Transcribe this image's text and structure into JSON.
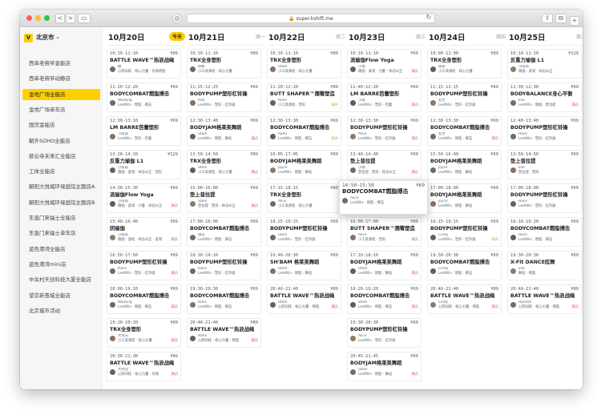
{
  "browser": {
    "url": "super.kshift.me",
    "back": "<",
    "forward": ">",
    "sidebar_toggle": "▭",
    "share": "⇧",
    "tabs": "⧉",
    "new_tab": "+",
    "colors": {
      "close": "#fd5f57",
      "min": "#febc2e",
      "max": "#28c840"
    }
  },
  "sidebar": {
    "logo": "V",
    "city": "北京市",
    "items": [
      {
        "label": "西单老佛爷金能店"
      },
      {
        "label": "西单老佛爷动静店"
      },
      {
        "label": "金地广场全能店",
        "active": true
      },
      {
        "label": "金地广场单车店"
      },
      {
        "label": "国贸金能店"
      },
      {
        "label": "朝外SOHO全能店"
      },
      {
        "label": "慈云寺未来汇全能店"
      },
      {
        "label": "工体全能店"
      },
      {
        "label": "朝阳大悦城环境庭院主题店A"
      },
      {
        "label": "朝阳大悦城环境庭院主题店B"
      },
      {
        "label": "东直门来福士全能店"
      },
      {
        "label": "东直门来福士单车店"
      },
      {
        "label": "蓝色港湾全能店"
      },
      {
        "label": "蓝色港湾mini店"
      },
      {
        "label": "中关村天创科技大厦全能店"
      },
      {
        "label": "望京新荟城全能店"
      },
      {
        "label": "北京城市活动"
      }
    ]
  },
  "days": [
    {
      "date": "10月20日",
      "weekday": "今天",
      "today": true,
      "classes": [
        {
          "time": "10:10-11:10",
          "price": "¥89",
          "name": "BATTLE WAVE™热浪战绳",
          "coach": "糖",
          "info": "心肺训练 · 核心力量 · 有氧燃脂"
        },
        {
          "time": "11:20-12:20",
          "price": "¥69",
          "name": "BODYCOMBAT燃脂搏击",
          "coach": "Wanting",
          "info": "LesMills · 燃脂 · 搏击"
        },
        {
          "time": "12:30-13:10",
          "price": "¥69",
          "name": "LM BARRE芭蕾塑形",
          "coach": "小南南",
          "info": "LesMills · 塑形 · 芭蕾"
        },
        {
          "time": "13:20-14:20",
          "price": "¥129",
          "name": "反重力瑜伽 L1",
          "coach": "小南南",
          "info": "瑜伽 · 柔韧 · 体态纠正 · 塑形"
        },
        {
          "time": "14:30-15:30",
          "price": "¥69",
          "name": "流瑜伽Flow Yoga",
          "coach": "小南南",
          "info": "瑜伽 · 柔韧 · 力量 · 体态纠正",
          "badge": "满员"
        },
        {
          "time": "15:40-16:40",
          "price": "¥69",
          "name": "阴瑜伽",
          "coach": "小南南",
          "info": "瑜伽 · 放松 · 体态纠正 · 柔韧",
          "badge": "满员"
        },
        {
          "time": "16:50-17:50",
          "price": "¥69",
          "name": "BODYPUMP塑形杠铃操",
          "coach": "Hans",
          "info": "LesMills · 塑形 · 杠铃操",
          "badge": "满员"
        },
        {
          "time": "18:00-19:10",
          "price": "¥69",
          "name": "BODYCOMBAT燃脂搏击",
          "coach": "Wanting",
          "info": "LesMills · 燃脂 · 搏击",
          "badge": "满员"
        },
        {
          "time": "19:20-20:20",
          "price": "¥89",
          "name": "TRX全身塑形",
          "coach": "大师兄",
          "info": "小工具课程 · 核心力量",
          "badge": "满员"
        },
        {
          "time": "20:30-21:30",
          "price": "¥89",
          "name": "BATTLE WAVE™热浪战绳",
          "coach": "大师兄",
          "info": "心肺训练 · 核心力量 · 有氧",
          "badge": "满员"
        }
      ]
    },
    {
      "date": "10月21日",
      "weekday": "周一",
      "today": false,
      "classes": [
        {
          "time": "10:10-11:10",
          "price": "¥89",
          "name": "TRX全身塑形",
          "coach": "杨帆",
          "info": "小工具课程 · 核心力量"
        },
        {
          "time": "11:25-12:25",
          "price": "¥69",
          "name": "BODYPUMP塑形杠铃操",
          "coach": "Ada",
          "info": "LesMills · 塑形 · 杠铃操"
        },
        {
          "time": "12:30-13:40",
          "price": "¥69",
          "name": "BODYJAM格莱美舞蹈",
          "coach": "Stark",
          "info": "LesMills · 燃脂 · 舞蹈",
          "badge": "满员"
        },
        {
          "time": "13:50-14:50",
          "price": "¥89",
          "name": "TRX全身塑形",
          "coach": "Stark",
          "info": "小工具课程 · 核心力量",
          "badge": "满员"
        },
        {
          "time": "15:00-16:00",
          "price": "¥69",
          "name": "垫上普拉提",
          "coach": "Stark",
          "info": "普拉提 · 塑形 · 体态纠正",
          "badge": "满员"
        },
        {
          "time": "17:00-18:00",
          "price": "¥69",
          "name": "BODYCOMBAT燃脂搏击",
          "coach": "演员",
          "info": "LesMills · 燃脂 · 搏击"
        },
        {
          "time": "18:10-19:10",
          "price": "¥69",
          "name": "BODYPUMP塑形杠铃操",
          "coach": "Hans",
          "info": "LesMills · 塑形 · 杠铃操"
        },
        {
          "time": "19:30-20:30",
          "price": "¥69",
          "name": "BODYCOMBAT燃脂搏击",
          "coach": "Hans",
          "info": "LesMills · 燃脂 · 搏击"
        },
        {
          "time": "20:40-21:40",
          "price": "¥89",
          "name": "BATTLE WAVE™热浪战绳",
          "coach": "Hans",
          "info": "心肺训练 · 核心力量 · 燃脂",
          "badge": "满员"
        }
      ]
    },
    {
      "date": "10月22日",
      "weekday": "周二",
      "today": false,
      "classes": [
        {
          "time": "10:10-11:10",
          "price": "¥89",
          "name": "TRX全身塑形",
          "coach": "Stark",
          "info": "小工具课程 · 核心力量"
        },
        {
          "time": "11:20-12:20",
          "price": "¥89",
          "name": "BUTT SHAPER™翘臀塑造",
          "coach": "Ruho",
          "info": "小工具课程 · 塑形",
          "badge": "候补"
        },
        {
          "time": "12:30-13:30",
          "price": "¥69",
          "name": "BODYCOMBAT燃脂搏击",
          "coach": "Ruho",
          "info": "LesMills · 燃脂 · 搏击",
          "badge": "候补"
        },
        {
          "time": "16:05-17:05",
          "price": "¥69",
          "name": "BODYJAM格莱美舞蹈",
          "coach": "Joyce",
          "info": "LesMills · 燃脂 · 舞蹈"
        },
        {
          "time": "17:15-18:15",
          "price": "¥89",
          "name": "TRX全身塑形",
          "coach": "Alice",
          "info": "小工具课程 · 核心力量"
        },
        {
          "time": "18:25-19:25",
          "price": "¥69",
          "name": "BODYPUMP塑形杠铃操",
          "coach": "Stark",
          "info": "LesMills · 塑形 · 杠铃操"
        },
        {
          "time": "19:40-20:30",
          "price": "¥69",
          "name": "SH'BAM 格莱美舞蹈",
          "coach": "Stark",
          "info": "LesMills · 燃脂 · 舞蹈"
        },
        {
          "time": "20:40-21:40",
          "price": "¥89",
          "name": "BATTLE WAVE™热浪战绳",
          "coach": "Stark",
          "info": "心肺训练 · 核心力量 · 燃脂",
          "badge": "满员"
        }
      ]
    },
    {
      "date": "10月23日",
      "weekday": "周三",
      "today": false,
      "classes": [
        {
          "time": "10:10-11:10",
          "price": "¥69",
          "name": "流瑜伽Flow Yoga",
          "coach": "小瑞",
          "info": "瑜伽 · 柔韧 · 力量 · 体态纠正",
          "badge": "满员"
        },
        {
          "time": "11:40-12:20",
          "price": "¥69",
          "name": "LM BARRE芭蕾塑形",
          "coach": "小瑞",
          "info": "LesMills · 塑形 · 芭蕾",
          "badge": "满员"
        },
        {
          "time": "12:30-13:30",
          "price": "¥69",
          "name": "BODYPUMP塑形杠铃操",
          "coach": "Alice",
          "info": "LesMills · 塑形 · 杠铃操",
          "badge": "满员"
        },
        {
          "time": "13:40-14:40",
          "price": "¥69",
          "name": "垫上普拉提",
          "coach": "小瑞",
          "info": "普拉提 · 塑形 · 体态纠正",
          "badge": "满员"
        },
        {
          "time": "14:50-15:50",
          "price": "¥69",
          "name": "BODYCOMBAT燃脂搏击",
          "coach": "Alice",
          "info": "LesMills · 燃脂 · 搏击",
          "popup": true
        },
        {
          "time": "16:00-17:00",
          "price": "¥89",
          "name": "BUTT SHAPER™翘臀塑造",
          "coach": "Alice",
          "info": "小工具课程 · 塑形",
          "badge": "满员"
        },
        {
          "time": "17:10-18:10",
          "price": "¥69",
          "name": "BODYJAM格莱美舞蹈",
          "coach": "Stark",
          "info": "LesMills · 燃脂 · 舞蹈",
          "badge": "满员"
        },
        {
          "time": "18:20-19:20",
          "price": "¥69",
          "name": "BODYCOMBAT燃脂搏击",
          "coach": "Stark",
          "info": "LesMills · 燃脂 · 搏击",
          "badge": "满员"
        },
        {
          "time": "19:30-20:30",
          "price": "¥69",
          "name": "BODYPUMP塑形杠铃操",
          "coach": "Alice",
          "info": "LesMills · 塑形 · 杠铃操"
        },
        {
          "time": "20:45-21:45",
          "price": "¥69",
          "name": "BODYJAM格莱美舞蹈",
          "coach": "Stark",
          "info": "LesMills · 燃脂 · 舞蹈",
          "badge": "满员"
        }
      ]
    },
    {
      "date": "10月24日",
      "weekday": "周四",
      "today": false,
      "classes": [
        {
          "time": "10:00-11:00",
          "price": "¥89",
          "name": "TRX全身塑形",
          "coach": "萌萌",
          "info": "小工具课程 · 核心力量"
        },
        {
          "time": "11:15-12:15",
          "price": "¥69",
          "name": "BODYPUMP塑形杠铃操",
          "coach": "宏文",
          "info": "LesMills · 塑形 · 杠铃操"
        },
        {
          "time": "12:30-13:30",
          "price": "¥69",
          "name": "BODYCOMBAT燃脂搏击",
          "coach": "宏文",
          "info": "LesMills · 燃脂 · 搏击",
          "badge": "满员"
        },
        {
          "time": "15:50-16:40",
          "price": "¥69",
          "name": "BODYJAM格莱美舞蹈",
          "coach": "Joyce",
          "info": "LesMills · 燃脂 · 舞蹈"
        },
        {
          "time": "17:00-18:00",
          "price": "¥69",
          "name": "BODYJAM格莱美舞蹈",
          "coach": "Joyce",
          "info": "LesMills · 燃脂 · 舞蹈"
        },
        {
          "time": "18:15-19:15",
          "price": "¥69",
          "name": "BODYPUMP塑形杠铃操",
          "coach": "Cindy",
          "info": "LesMills · 塑形 · 杠铃操",
          "badge": "候补"
        },
        {
          "time": "19:30-20:30",
          "price": "¥69",
          "name": "BODYCOMBAT燃脂搏击",
          "coach": "Cindy",
          "info": "LesMills · 燃脂 · 搏击"
        },
        {
          "time": "20:40-21:40",
          "price": "¥89",
          "name": "BATTLE WAVE™热浪战绳",
          "coach": "Cindy",
          "info": "心肺训练 · 核心力量 · 燃脂",
          "badge": "满员"
        }
      ]
    },
    {
      "date": "10月25日",
      "weekday": "周五",
      "today": false,
      "classes": [
        {
          "time": "10:10-11:10",
          "price": "¥129",
          "name": "反重力瑜伽 L1",
          "coach": "小南南",
          "info": "瑜伽 · 柔韧 · 体态纠正"
        },
        {
          "time": "11:30-12:30",
          "price": "¥69",
          "name": "BODYBALANCE身心平衡",
          "coach": "Ella",
          "info": "LesMills · 瑜伽 · 普拉提",
          "badge": "满员"
        },
        {
          "time": "12:40-13:40",
          "price": "¥69",
          "name": "BODYPUMP塑形杠铃操",
          "coach": "Hans",
          "info": "LesMills · 塑形 · 杠铃操"
        },
        {
          "time": "13:50-14:50",
          "price": "¥69",
          "name": "垫上普拉提",
          "coach": "Ella",
          "info": "普拉提 · 塑形"
        },
        {
          "time": "17:00-18:00",
          "price": "¥69",
          "name": "BODYPUMP塑形杠铃操",
          "coach": "Hans",
          "info": "LesMills · 塑形 · 杠铃操"
        },
        {
          "time": "18:10-19:20",
          "price": "¥69",
          "name": "BODYCOMBAT燃脂搏击",
          "coach": "Hans",
          "info": "LesMills · 燃脂 · 搏击"
        },
        {
          "time": "19:30-20:30",
          "price": "¥69",
          "name": "X-Fit DANCE炫舞",
          "coach": "Ella",
          "info": "舞蹈 · 燃脂"
        },
        {
          "time": "20:40-21:40",
          "price": "¥89",
          "name": "BATTLE WAVE™热浪战绳",
          "coach": "Hansen",
          "info": "心肺训练 · 核心力量 · 燃脂",
          "badge": "满员"
        }
      ]
    }
  ],
  "colors": {
    "accent": "#ffcf00",
    "full_badge": "#e55555"
  }
}
